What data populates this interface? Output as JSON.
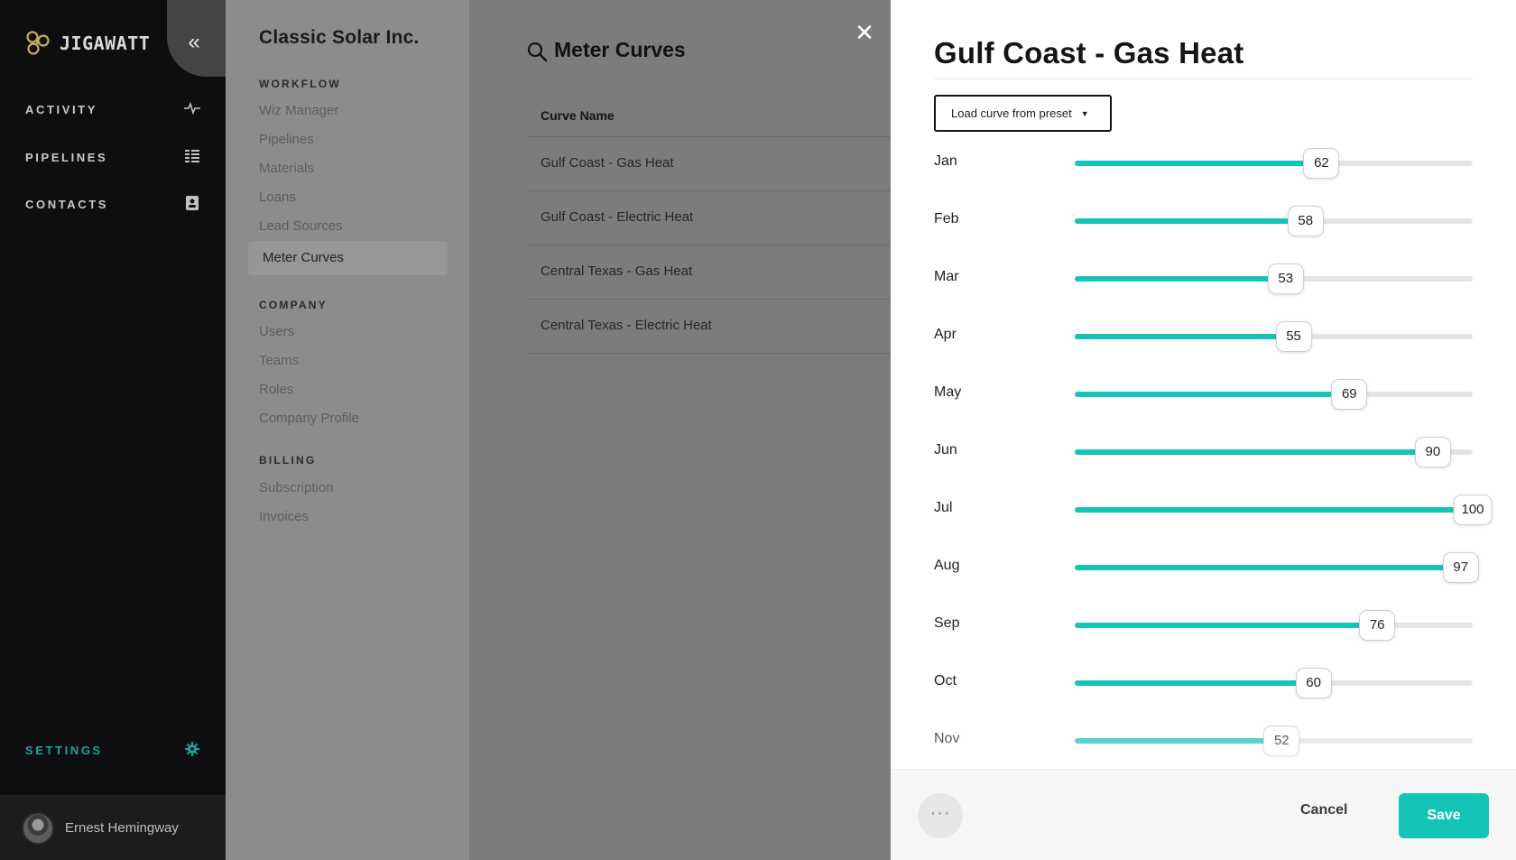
{
  "app": {
    "logo_text": "JIGAWATT",
    "nav": [
      {
        "label": "ACTIVITY",
        "icon": "activity-pulse-icon"
      },
      {
        "label": "PIPELINES",
        "icon": "list-grid-icon"
      },
      {
        "label": "CONTACTS",
        "icon": "contact-card-icon"
      }
    ],
    "settings_label": "SETTINGS",
    "settings_icon": "gear-icon",
    "user_name": "Ernest Hemingway",
    "accent_color": "#14c4b6"
  },
  "subnav": {
    "company": "Classic Solar Inc.",
    "workflow_title": "WORKFLOW",
    "workflow": [
      "Wiz Manager",
      "Pipelines",
      "Materials",
      "Loans",
      "Lead Sources",
      "Meter Curves"
    ],
    "company_title": "COMPANY",
    "company_items": [
      "Users",
      "Teams",
      "Roles",
      "Company Profile"
    ],
    "billing_title": "BILLING",
    "billing": [
      "Subscription",
      "Invoices"
    ]
  },
  "list": {
    "title": "Meter Curves",
    "column_header": "Curve Name",
    "rows": [
      "Gulf Coast - Gas Heat",
      "Gulf Coast - Electric Heat",
      "Central Texas - Gas Heat",
      "Central Texas - Electric Heat"
    ]
  },
  "panel": {
    "title": "Gulf Coast - Gas Heat",
    "preset_label": "Load curve from preset",
    "months": [
      {
        "label": "Jan",
        "value": 62
      },
      {
        "label": "Feb",
        "value": 58
      },
      {
        "label": "Mar",
        "value": 53
      },
      {
        "label": "Apr",
        "value": 55
      },
      {
        "label": "May",
        "value": 69
      },
      {
        "label": "Jun",
        "value": 90
      },
      {
        "label": "Jul",
        "value": 100
      },
      {
        "label": "Aug",
        "value": 97
      },
      {
        "label": "Sep",
        "value": 76
      },
      {
        "label": "Oct",
        "value": 60
      },
      {
        "label": "Nov",
        "value": 52
      }
    ],
    "slider_max": 100,
    "more_label": "···",
    "cancel_label": "Cancel",
    "save_label": "Save"
  }
}
